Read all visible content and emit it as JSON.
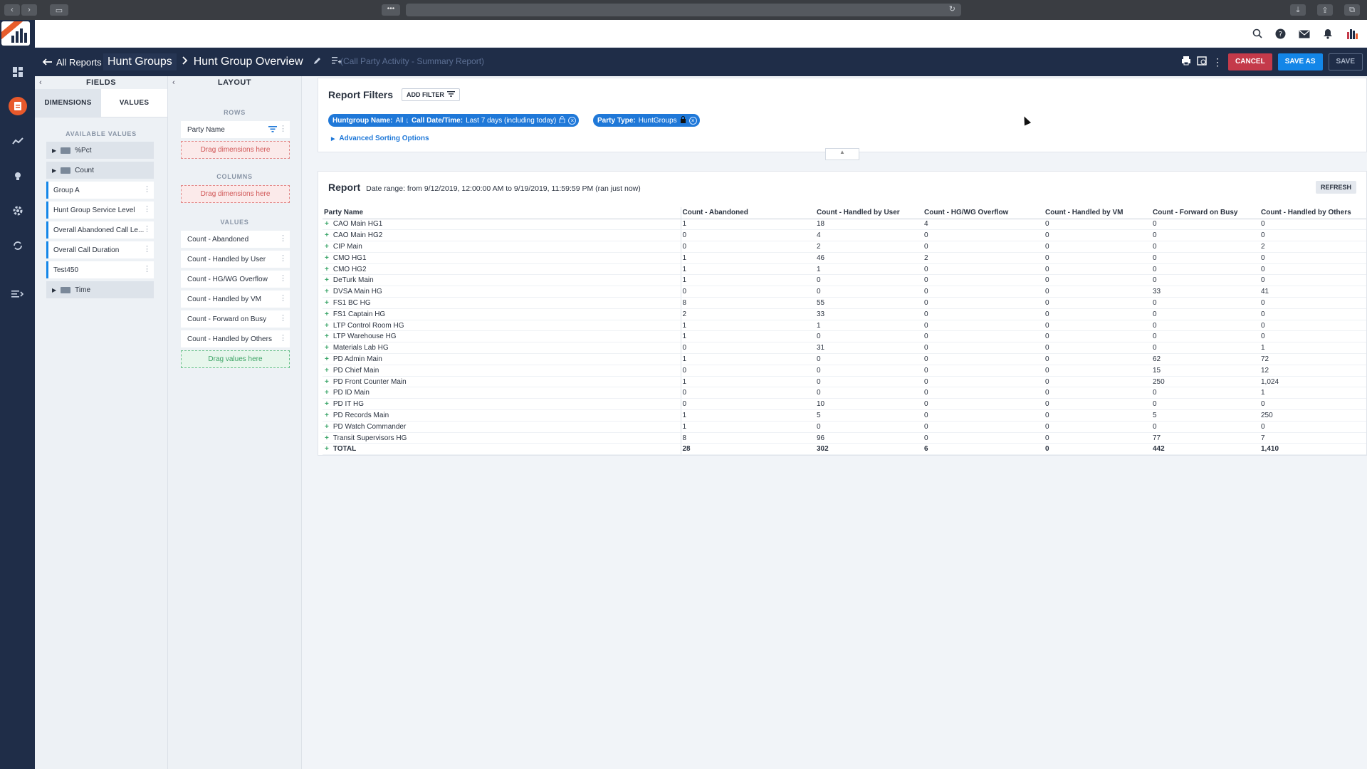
{
  "app": {
    "back_label": "All Reports",
    "breadcrumb_root": "Hunt Groups",
    "breadcrumb_current": "Hunt Group Overview",
    "subtitle": "(Call Party Activity - Summary Report)",
    "buttons": {
      "cancel": "CANCEL",
      "save_as": "SAVE AS",
      "save": "SAVE"
    }
  },
  "fields_panel": {
    "title": "FIELDS",
    "tabs": [
      "DIMENSIONS",
      "VALUES"
    ],
    "available_label": "AVAILABLE VALUES",
    "items": [
      {
        "label": "%Pct",
        "type": "folder"
      },
      {
        "label": "Count",
        "type": "folder"
      },
      {
        "label": "Group A",
        "type": "value"
      },
      {
        "label": "Hunt Group Service Level",
        "type": "value"
      },
      {
        "label": "Overall Abandoned Call Le...",
        "type": "value"
      },
      {
        "label": "Overall Call Duration",
        "type": "value"
      },
      {
        "label": "Test450",
        "type": "value"
      },
      {
        "label": "Time",
        "type": "folder"
      }
    ]
  },
  "layout_panel": {
    "title": "LAYOUT",
    "rows_label": "ROWS",
    "rows": [
      "Party Name"
    ],
    "rows_drop": "Drag dimensions here",
    "columns_label": "COLUMNS",
    "columns_drop": "Drag dimensions here",
    "values_label": "VALUES",
    "values": [
      "Count - Abandoned",
      "Count - Handled by User",
      "Count - HG/WG Overflow",
      "Count - Handled by VM",
      "Count - Forward on Busy",
      "Count - Handled by Others"
    ],
    "values_drop": "Drag values here"
  },
  "filters": {
    "title": "Report Filters",
    "add_filter": "ADD FILTER",
    "chips": [
      {
        "key": "Huntgroup Name:",
        "value": "All"
      },
      {
        "key": "Call Date/Time:",
        "value": "Last 7 days (including today)"
      },
      {
        "key": "Party Type:",
        "value": "HuntGroups"
      }
    ],
    "advanced": "Advanced Sorting Options"
  },
  "report": {
    "title": "Report",
    "date_range": "Date range: from 9/12/2019, 12:00:00 AM to 9/19/2019, 11:59:59 PM (ran just now)",
    "refresh": "REFRESH",
    "columns": [
      "Party Name",
      "Count - Abandoned",
      "Count - Handled by User",
      "Count - HG/WG Overflow",
      "Count - Handled by VM",
      "Count - Forward on Busy",
      "Count - Handled by Others"
    ],
    "rows": [
      [
        "CAO Main HG1",
        "1",
        "18",
        "4",
        "0",
        "0",
        "0"
      ],
      [
        "CAO Main HG2",
        "0",
        "4",
        "0",
        "0",
        "0",
        "0"
      ],
      [
        "CIP Main",
        "0",
        "2",
        "0",
        "0",
        "0",
        "2"
      ],
      [
        "CMO HG1",
        "1",
        "46",
        "2",
        "0",
        "0",
        "0"
      ],
      [
        "CMO HG2",
        "1",
        "1",
        "0",
        "0",
        "0",
        "0"
      ],
      [
        "DeTurk Main",
        "1",
        "0",
        "0",
        "0",
        "0",
        "0"
      ],
      [
        "DVSA Main HG",
        "0",
        "0",
        "0",
        "0",
        "33",
        "41"
      ],
      [
        "FS1 BC HG",
        "8",
        "55",
        "0",
        "0",
        "0",
        "0"
      ],
      [
        "FS1 Captain HG",
        "2",
        "33",
        "0",
        "0",
        "0",
        "0"
      ],
      [
        "LTP Control Room HG",
        "1",
        "1",
        "0",
        "0",
        "0",
        "0"
      ],
      [
        "LTP Warehouse HG",
        "1",
        "0",
        "0",
        "0",
        "0",
        "0"
      ],
      [
        "Materials Lab HG",
        "0",
        "31",
        "0",
        "0",
        "0",
        "1"
      ],
      [
        "PD Admin Main",
        "1",
        "0",
        "0",
        "0",
        "62",
        "72"
      ],
      [
        "PD Chief Main",
        "0",
        "0",
        "0",
        "0",
        "15",
        "12"
      ],
      [
        "PD Front Counter Main",
        "1",
        "0",
        "0",
        "0",
        "250",
        "1,024"
      ],
      [
        "PD ID Main",
        "0",
        "0",
        "0",
        "0",
        "0",
        "1"
      ],
      [
        "PD IT HG",
        "0",
        "10",
        "0",
        "0",
        "0",
        "0"
      ],
      [
        "PD Records Main",
        "1",
        "5",
        "0",
        "0",
        "5",
        "250"
      ],
      [
        "PD Watch Commander",
        "1",
        "0",
        "0",
        "0",
        "0",
        "0"
      ],
      [
        "Transit Supervisors HG",
        "8",
        "96",
        "0",
        "0",
        "77",
        "7"
      ]
    ],
    "total": [
      "TOTAL",
      "28",
      "302",
      "6",
      "0",
      "442",
      "1,410"
    ]
  }
}
